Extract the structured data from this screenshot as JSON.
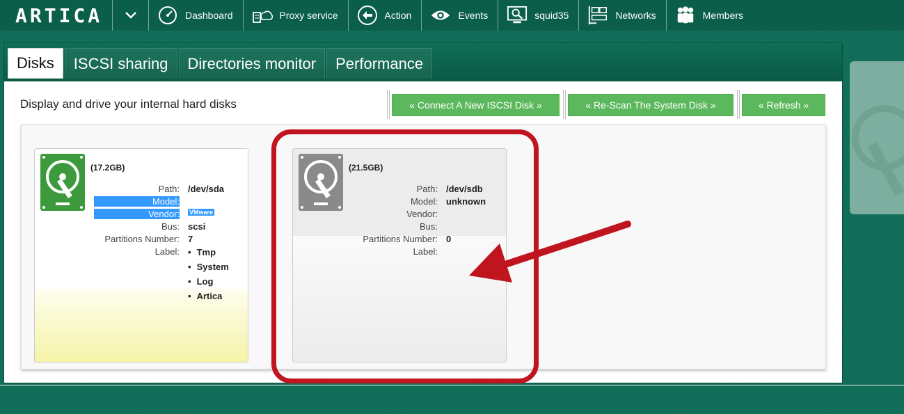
{
  "brand": {
    "logo": "ARTICA"
  },
  "nav": [
    {
      "label": "Dashboard",
      "icon": "speedometer-icon"
    },
    {
      "label": "Proxy service",
      "icon": "cloud-server-icon"
    },
    {
      "label": "Action",
      "icon": "back-arrow-icon"
    },
    {
      "label": "Events",
      "icon": "eye-icon"
    },
    {
      "label": "squid35",
      "icon": "monitor-search-icon"
    },
    {
      "label": "Networks",
      "icon": "network-icon"
    },
    {
      "label": "Members",
      "icon": "users-icon"
    }
  ],
  "tabs": [
    "Disks",
    "ISCSI sharing",
    "Directories monitor",
    "Performance"
  ],
  "intro": "Display and drive your internal hard disks",
  "buttons": {
    "connect": "« Connect A New ISCSI Disk »",
    "rescan": "« Re-Scan The System Disk »",
    "refresh": "« Refresh »"
  },
  "field_labels": {
    "path": "Path:",
    "model": "Model:",
    "vendor": "Vendor:",
    "bus": "Bus:",
    "partitions": "Partitions Number:",
    "label": "Label:"
  },
  "disks": [
    {
      "size": "(17.2GB)",
      "path": "/dev/sda",
      "model": "",
      "vendor": "VMware",
      "bus": "scsi",
      "partitions": "7",
      "labels": [
        "Tmp",
        "System",
        "Log",
        "Artica"
      ]
    },
    {
      "size": "(21.5GB)",
      "path": "/dev/sdb",
      "model": "unknown",
      "vendor": "",
      "bus": "",
      "partitions": "0",
      "labels": []
    }
  ],
  "colors": {
    "brand_green": "#0a5e4a",
    "button_green": "#5cb85c",
    "callout_red": "#c0141e"
  }
}
